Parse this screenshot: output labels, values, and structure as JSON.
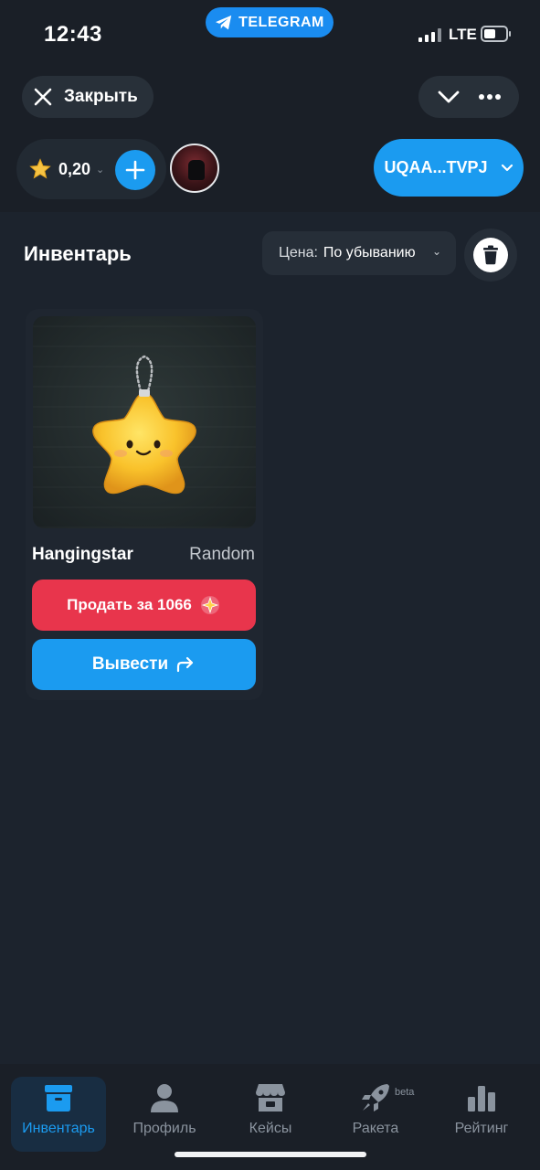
{
  "status_bar": {
    "time": "12:43",
    "pill_label": "TELEGRAM",
    "network": "LTE"
  },
  "top": {
    "close_label": "Закрыть",
    "balance": "0,20",
    "wallet_address": "UQAA...TVPJ"
  },
  "inventory": {
    "title": "Инвентарь",
    "sort_label": "Цена:",
    "sort_value": "По убыванию"
  },
  "items": [
    {
      "name": "Hangingstar",
      "tag": "Random",
      "sell_label": "Продать за 1066",
      "withdraw_label": "Вывести"
    }
  ],
  "bottom_nav": {
    "items": [
      {
        "label": "Инвентарь",
        "icon": "box-icon",
        "active": true
      },
      {
        "label": "Профиль",
        "icon": "person-icon",
        "active": false
      },
      {
        "label": "Кейсы",
        "icon": "shop-icon",
        "active": false
      },
      {
        "label": "Ракета",
        "icon": "rocket-icon",
        "active": false,
        "badge": "beta"
      },
      {
        "label": "Рейтинг",
        "icon": "bar-chart-icon",
        "active": false
      }
    ]
  },
  "colors": {
    "background": "#1c232d",
    "accent_blue": "#1b9bf0",
    "sell_red": "#e8354c",
    "nav_active_bg": "#182d42"
  }
}
